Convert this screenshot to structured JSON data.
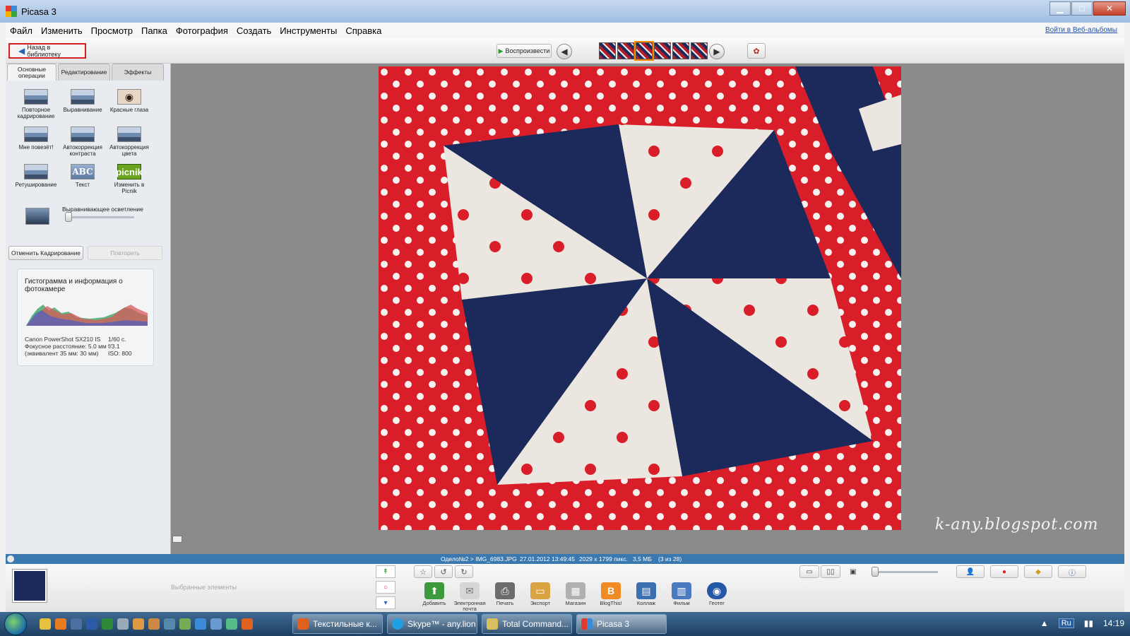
{
  "window": {
    "title": "Picasa 3",
    "login_link": "Войти в Веб-альбомы"
  },
  "menu": [
    "Файл",
    "Изменить",
    "Просмотр",
    "Папка",
    "Фотография",
    "Создать",
    "Инструменты",
    "Справка"
  ],
  "toolbar": {
    "back_label": "Назад в библиотеку",
    "play_label": "Воспроизвести"
  },
  "tabs": [
    "Основные операции",
    "Редактирование",
    "Эффекты"
  ],
  "tools": [
    {
      "label": "Повторное кадрирование",
      "icon": "crop-icon"
    },
    {
      "label": "Выравнивание",
      "icon": "straighten-icon"
    },
    {
      "label": "Красные глаза",
      "icon": "red-eye-icon"
    },
    {
      "label": "Мне повезёт!",
      "icon": "lucky-icon"
    },
    {
      "label": "Автокоррекция контраста",
      "icon": "auto-contrast-icon"
    },
    {
      "label": "Автокоррекция цвета",
      "icon": "auto-color-icon"
    },
    {
      "label": "Ретуширование",
      "icon": "retouch-icon"
    },
    {
      "label": "Текст",
      "icon": "text-icon",
      "glyph": "ABC"
    },
    {
      "label": "Изменить в Picnik",
      "icon": "picnik-icon",
      "glyph": "picnik"
    }
  ],
  "fill_light": {
    "label": "Выравнивающее осветление",
    "value": 0
  },
  "undo_label": "Отменить Кадрирование",
  "redo_label": "Повторить",
  "histogram": {
    "title": "Гистограмма и информация о фотокамере",
    "camera": [
      [
        "Canon PowerShot SX210 IS",
        "1/60 с."
      ],
      [
        "Фокусное расстояние: 5.0 мм",
        "f/3.1"
      ],
      [
        "(эквивалент 35 мм:  30 мм)",
        "ISO: 800"
      ]
    ]
  },
  "watermark": "k-any.blogspot.com",
  "status": {
    "path": "Одело№2 > IMG_6983.JPG",
    "date": "27.01.2012 13:49:45",
    "dims": "2029 x 1799 пикс.",
    "size": "3,5 МБ",
    "count": "(3 из 28)"
  },
  "tray": {
    "hint": "Выбранные элементы"
  },
  "actions": [
    {
      "label": "Добавить",
      "color": "#3c9a3c",
      "glyph": "⬆"
    },
    {
      "label": "Электронная почта",
      "color": "#d6d6d6",
      "glyph": "✉"
    },
    {
      "label": "Печать",
      "color": "#6c6c6c",
      "glyph": "⎙"
    },
    {
      "label": "Экспорт",
      "color": "#d9a441",
      "glyph": "▭"
    },
    {
      "label": "Магазин",
      "color": "#b0b0b0",
      "glyph": "▦"
    },
    {
      "label": "BlogThis!",
      "color": "#f08a24",
      "glyph": "B"
    },
    {
      "label": "Коллаж",
      "color": "#3c6fb0",
      "glyph": "▤"
    },
    {
      "label": "Фильм",
      "color": "#4a7ac0",
      "glyph": "▥"
    },
    {
      "label": "Геотег",
      "color": "#2457a6",
      "glyph": "◉"
    }
  ],
  "taskbar": {
    "tasks": [
      "Текстильные к...",
      "Skype™ - any.lion",
      "Total Command...",
      "Picasa 3"
    ],
    "lang": "Ru",
    "time": "14:19"
  }
}
